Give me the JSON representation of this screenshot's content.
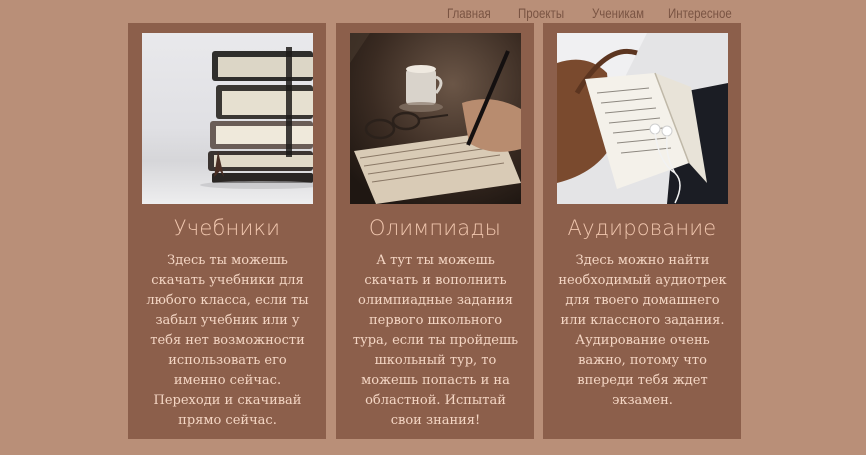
{
  "nav": {
    "items": [
      "Главная",
      "Проекты",
      "Ученикам",
      "Интересное"
    ]
  },
  "cards": [
    {
      "title": "Учебники",
      "text": "Здесь ты можешь скачать учебники для любого класса, если ты забыл учебник или у тебя нет возможности использовать его именно сейчас. Переходи и скачивай прямо сейчас."
    },
    {
      "title": "Олимпиады",
      "text": "А тут ты можешь скачать и вополнить олимпиадные задания первого школьного тура, если ты пройдешь школьный тур, то можешь попасть и на областной. Испытай свои знания!"
    },
    {
      "title": "Аудирование",
      "text": "Здесь можно найти необходимый аудиотрек для твоего домашнего или классного задания. Аудирование очень важно, потому что впереди тебя ждет экзамен."
    }
  ],
  "colors": {
    "page_bg": "#b98f78",
    "card_bg": "#8c5f4b",
    "title": "#f0c6ae",
    "text": "#f4d6c4",
    "nav_text": "#7a5443"
  }
}
